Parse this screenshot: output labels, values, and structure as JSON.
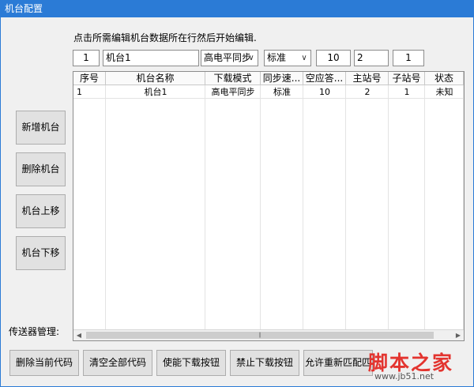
{
  "window": {
    "title": "机台配置"
  },
  "instruction": "点击所需编辑机台数据所在行然后开始编辑.",
  "editor": {
    "index": "1",
    "name": "机台1",
    "download_mode": "高电平同步",
    "sync_speed": "标准",
    "idle_timeout": "10",
    "master_station": "2",
    "sub_station": "1"
  },
  "table": {
    "headers": [
      "序号",
      "机台名称",
      "下载模式",
      "同步速...",
      "空应答...",
      "主站号",
      "子站号",
      "状态"
    ],
    "rows": [
      [
        "1",
        "机台1",
        "高电平同步",
        "标准",
        "10",
        "2",
        "1",
        "未知"
      ]
    ]
  },
  "side_buttons": {
    "add": "新增机台",
    "delete": "删除机台",
    "move_up": "机台上移",
    "move_down": "机台下移"
  },
  "transmitter_label": "传送器管理:",
  "bottom_buttons": {
    "delete_current": "删除当前代码",
    "clear_all": "清空全部代码",
    "enable_download": "使能下载按钮",
    "disable_download": "禁止下载按钮",
    "allow_rematch": "允许重新匹配匹"
  },
  "watermark": {
    "title": "脚本之家",
    "url": "www.jb51.net"
  },
  "colors": {
    "titlebar": "#2b7bd6",
    "watermark": "#e3342f"
  }
}
